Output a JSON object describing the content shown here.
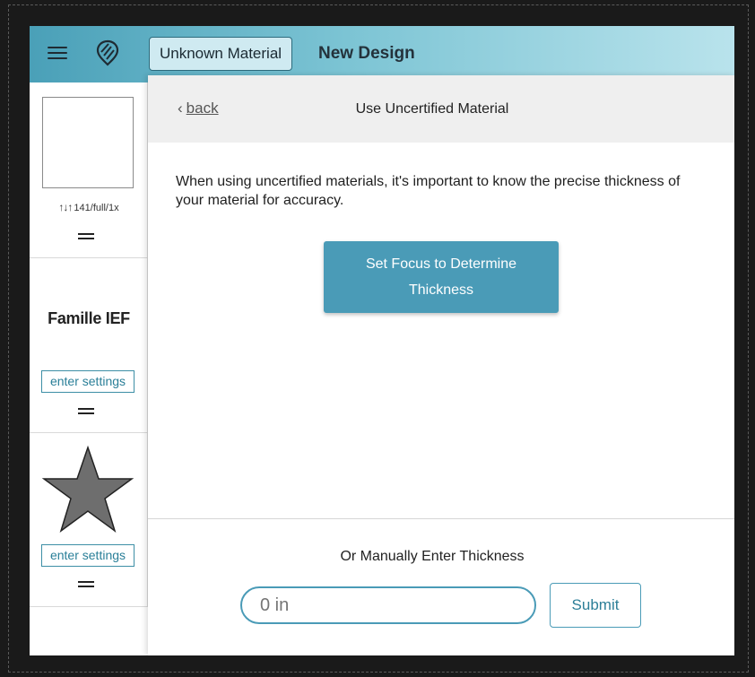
{
  "header": {
    "material_button": "Unknown Material",
    "design_title": "New Design"
  },
  "sidebar": {
    "cards": [
      {
        "settings_text": "141/full/1x"
      },
      {
        "title": "Famille IEF",
        "enter_settings": "enter settings"
      },
      {
        "enter_settings": "enter settings"
      }
    ]
  },
  "panel": {
    "back_label": "back",
    "title": "Use Uncertified Material",
    "description": "When using uncertified materials, it's important to know the precise thickness of your material for accuracy.",
    "focus_button_line1": "Set Focus to Determine",
    "focus_button_line2": "Thickness",
    "manual_label": "Or Manually Enter Thickness",
    "thickness_placeholder": "0 in",
    "submit_label": "Submit"
  },
  "colors": {
    "accent": "#4a9bb7",
    "header_gradient_start": "#4aa0b8",
    "header_gradient_end": "#b9e3ec",
    "page_background": "#1a1a1a"
  },
  "icons": [
    "menu-icon",
    "logo-icon",
    "sliders-icon",
    "drag-handle-icon",
    "star-icon",
    "chevron-left-icon"
  ]
}
